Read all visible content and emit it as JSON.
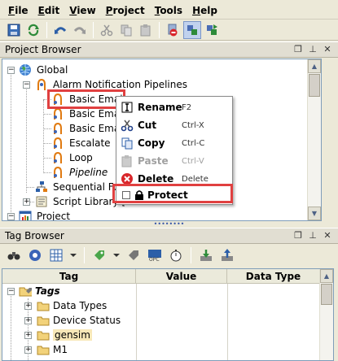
{
  "menu": [
    "File",
    "Edit",
    "View",
    "Project",
    "Tools",
    "Help"
  ],
  "menu_underline": [
    "F",
    "E",
    "V",
    "P",
    "T",
    "H"
  ],
  "project_browser": {
    "title": "Project Browser",
    "tree": [
      {
        "label": "Global",
        "icon": "globe-icon"
      },
      {
        "label": "Alarm Notification Pipelines",
        "icon": "alarm-pipeline-icon"
      },
      {
        "label": "Basic Email",
        "icon": "pipeline-icon"
      },
      {
        "label": "Basic Ema",
        "icon": "pipeline-icon"
      },
      {
        "label": "Basic Ema",
        "icon": "pipeline-icon"
      },
      {
        "label": "Escalate",
        "icon": "pipeline-icon"
      },
      {
        "label": "Loop",
        "icon": "pipeline-icon"
      },
      {
        "label": "Pipeline",
        "icon": "pipeline-icon"
      },
      {
        "label": "Sequential Fu",
        "icon": "sequential-icon"
      },
      {
        "label": "Script Library [",
        "icon": "script-library-icon"
      },
      {
        "label": "Project",
        "icon": "project-icon"
      }
    ]
  },
  "context_menu": {
    "items": [
      {
        "label": "Rename",
        "shortcut": "F2",
        "icon": "rename-icon",
        "enabled": true
      },
      {
        "label": "Cut",
        "shortcut": "Ctrl-X",
        "icon": "scissors-icon",
        "enabled": true
      },
      {
        "label": "Copy",
        "shortcut": "Ctrl-C",
        "icon": "copy-icon",
        "enabled": true
      },
      {
        "label": "Paste",
        "shortcut": "Ctrl-V",
        "icon": "paste-icon",
        "enabled": false
      },
      {
        "label": "Delete",
        "shortcut": "Delete",
        "icon": "delete-icon",
        "enabled": true
      },
      {
        "label": "Protect",
        "shortcut": "",
        "icon": "lock-icon",
        "enabled": true
      }
    ]
  },
  "tag_browser": {
    "title": "Tag Browser",
    "columns": [
      "Tag",
      "Value",
      "Data Type"
    ],
    "rows": [
      {
        "label": "Tags",
        "italic": true
      },
      {
        "label": "Data Types"
      },
      {
        "label": "Device Status"
      },
      {
        "label": "gensim"
      },
      {
        "label": "M1"
      }
    ]
  },
  "colors": {
    "highlight": "#e04040",
    "chrome": "#ECE9D8",
    "selection": "#c1d2ee"
  }
}
